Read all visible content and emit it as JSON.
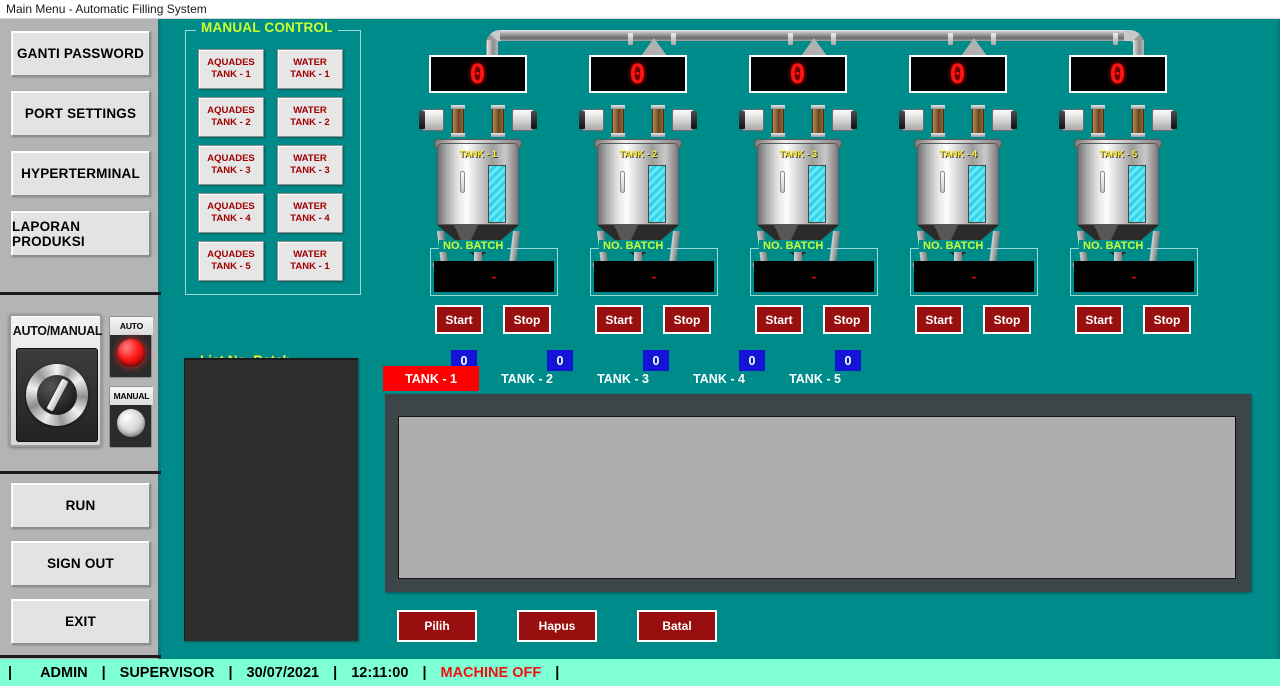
{
  "window": {
    "title": "Main Menu - Automatic Filling System"
  },
  "colors": {
    "background_teal": "#008b8b",
    "sidebar_grey": "#b4b4b4",
    "legend_yellow_green": "#ccff33",
    "label_yellow": "#ffee33",
    "led_red": "#ff1111",
    "button_dark_red": "#990f0f",
    "active_tab_red": "#ff0000",
    "badge_blue": "#1414d6",
    "statusbar_aquamarine": "#7fffd4",
    "alert_red": "#ee1111",
    "grid_grey": "#aeaeae",
    "listbox_dark": "#2e2e2e"
  },
  "sidebar": {
    "top_buttons": [
      {
        "label": "GANTI PASSWORD"
      },
      {
        "label": "PORT SETTINGS"
      },
      {
        "label": "HYPERTERMINAL"
      },
      {
        "label": "LAPORAN PRODUKSI"
      }
    ],
    "mode_selector": {
      "label": "AUTO/MANUAL",
      "lamps": [
        {
          "label": "AUTO",
          "state": "on"
        },
        {
          "label": "MANUAL",
          "state": "off"
        }
      ]
    },
    "bottom_buttons": [
      {
        "label": "RUN"
      },
      {
        "label": "SIGN OUT"
      },
      {
        "label": "EXIT"
      }
    ]
  },
  "manual_control": {
    "legend": "MANUAL CONTROL",
    "buttons": [
      {
        "line1": "AQUADES",
        "line2": "TANK - 1"
      },
      {
        "line1": "WATER",
        "line2": "TANK - 1"
      },
      {
        "line1": "AQUADES",
        "line2": "TANK - 2"
      },
      {
        "line1": "WATER",
        "line2": "TANK - 2"
      },
      {
        "line1": "AQUADES",
        "line2": "TANK - 3"
      },
      {
        "line1": "WATER",
        "line2": "TANK - 3"
      },
      {
        "line1": "AQUADES",
        "line2": "TANK - 4"
      },
      {
        "line1": "WATER",
        "line2": "TANK - 4"
      },
      {
        "line1": "AQUADES",
        "line2": "TANK - 5"
      },
      {
        "line1": "WATER",
        "line2": "TANK - 1"
      }
    ]
  },
  "tanks": [
    {
      "name": "TANK - 1",
      "counter": "0",
      "batch_legend": "NO. BATCH",
      "batch_value": "-",
      "start_label": "Start",
      "stop_label": "Stop"
    },
    {
      "name": "TANK - 2",
      "counter": "0",
      "batch_legend": "NO. BATCH",
      "batch_value": "-",
      "start_label": "Start",
      "stop_label": "Stop"
    },
    {
      "name": "TANK - 3",
      "counter": "0",
      "batch_legend": "NO. BATCH",
      "batch_value": "-",
      "start_label": "Start",
      "stop_label": "Stop"
    },
    {
      "name": "TANK - 4",
      "counter": "0",
      "batch_legend": "NO. BATCH",
      "batch_value": "-",
      "start_label": "Start",
      "stop_label": "Stop"
    },
    {
      "name": "TANK - 5",
      "counter": "0",
      "batch_legend": "NO. BATCH",
      "batch_value": "-",
      "start_label": "Start",
      "stop_label": "Stop"
    }
  ],
  "batch_list": {
    "label": "List No. Batch  :",
    "value": "-",
    "items": []
  },
  "tank_tabs": [
    {
      "label": "TANK - 1",
      "badge": "0",
      "active": true
    },
    {
      "label": "TANK - 2",
      "badge": "0",
      "active": false
    },
    {
      "label": "TANK - 3",
      "badge": "0",
      "active": false
    },
    {
      "label": "TANK - 4",
      "badge": "0",
      "active": false
    },
    {
      "label": "TANK - 5",
      "badge": "0",
      "active": false
    }
  ],
  "data_grid": {
    "rows": []
  },
  "action_buttons": [
    {
      "label": "Pilih"
    },
    {
      "label": "Hapus"
    },
    {
      "label": "Batal"
    }
  ],
  "statusbar": {
    "separator": "|",
    "user_role": "ADMIN",
    "access_level": "SUPERVISOR",
    "date": "30/07/2021",
    "time": "12:11:00",
    "machine_status": "MACHINE OFF"
  }
}
